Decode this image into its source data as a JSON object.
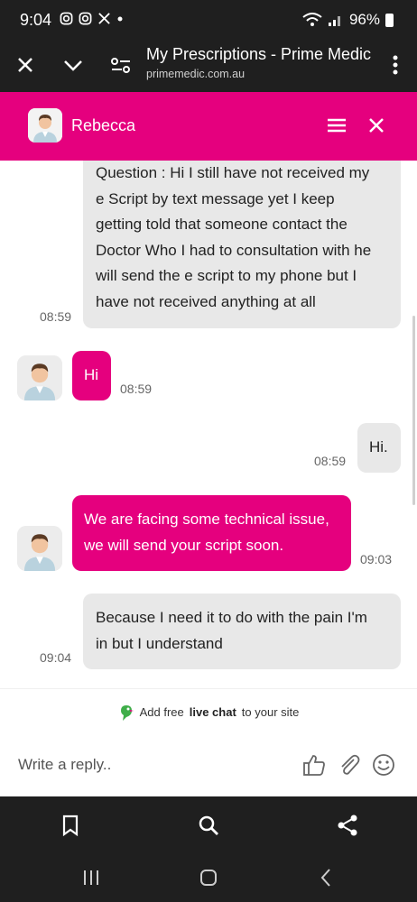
{
  "status_bar": {
    "time": "9:04",
    "battery": "96%"
  },
  "browser": {
    "page_title": "My Prescriptions - Prime Medic",
    "page_url": "primemedic.com.au"
  },
  "chat": {
    "agent_name": "Rebecca",
    "brand_color": "#e5007e",
    "messages": [
      {
        "from": "user",
        "lines": [
          "Question : Hi I still have not received my",
          "e Script by text message yet I keep",
          "getting told that someone contact the",
          "Doctor Who I had to consultation with he",
          "will send the e script to my phone but I",
          "have not received anything at all"
        ],
        "time": "08:59"
      },
      {
        "from": "agent",
        "lines": [
          "Hi"
        ],
        "time": "08:59"
      },
      {
        "from": "user",
        "lines": [
          "Hi."
        ],
        "time": "08:59"
      },
      {
        "from": "agent",
        "lines": [
          "We are facing some technical issue,",
          "we will send your script soon."
        ],
        "time": "09:03"
      },
      {
        "from": "user",
        "lines": [
          "Because I need it to do with the pain I'm",
          "in but I understand"
        ],
        "time": "09:04"
      }
    ]
  },
  "powered_by": {
    "prefix": "Add free",
    "bold": "live chat",
    "suffix": "to your site"
  },
  "composer": {
    "placeholder": "Write a reply.."
  },
  "icons": {
    "status": [
      "instagram-icon",
      "instagram-icon",
      "x-icon",
      "dot-icon",
      "mute-icon",
      "wifi-icon",
      "signal-icon",
      "battery-icon"
    ],
    "browser_top": [
      "close-icon",
      "chevron-down-icon",
      "site-settings-icon",
      "more-vert-icon"
    ],
    "header": [
      "menu-icon",
      "close-icon"
    ],
    "composer": [
      "thumbs-up-icon",
      "paperclip-icon",
      "emoji-icon"
    ],
    "browser_bottom": [
      "bookmark-icon",
      "search-icon",
      "share-icon"
    ],
    "nav": [
      "recents-icon",
      "home-icon",
      "back-icon"
    ]
  }
}
